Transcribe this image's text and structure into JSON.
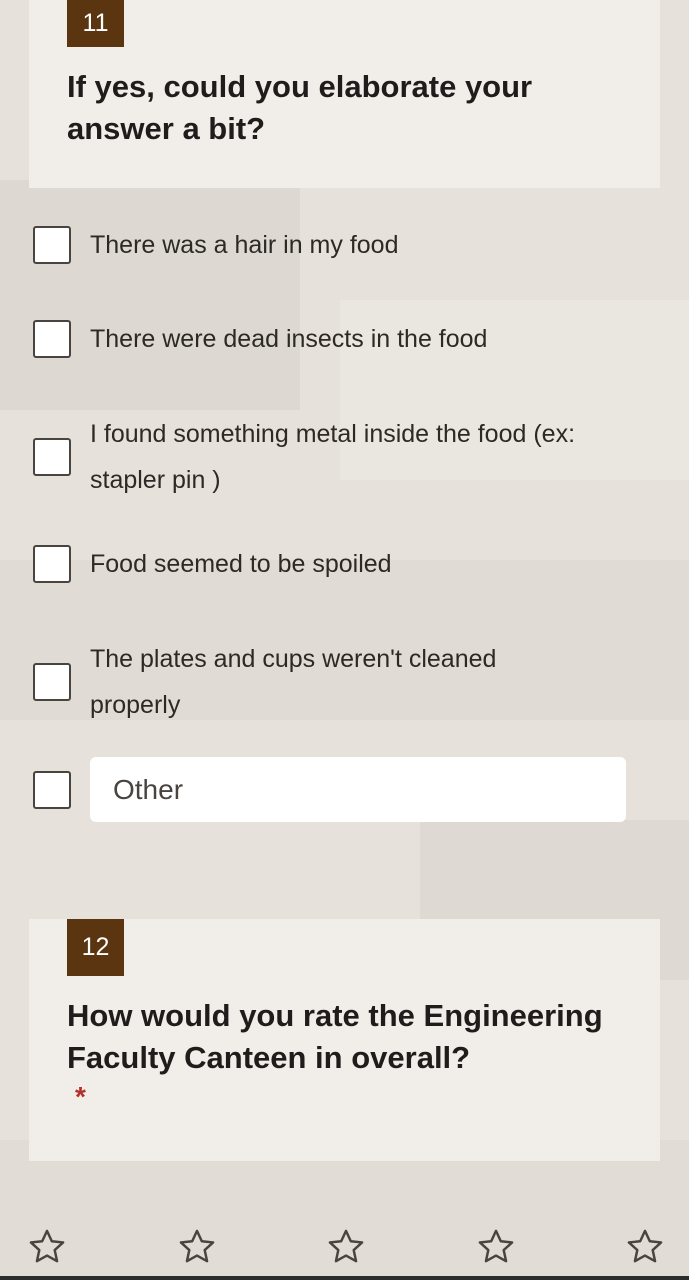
{
  "q11": {
    "number": "11",
    "title": "If yes, could you elaborate your answer a bit?",
    "options": [
      {
        "label": "There was a hair in my food"
      },
      {
        "label": "There were dead insects in the food"
      },
      {
        "label": "I found something metal inside the food (ex: stapler pin )"
      },
      {
        "label": "Food seemed to be spoiled"
      },
      {
        "label": "The plates and cups weren't cleaned properly"
      }
    ],
    "other_placeholder": "Other"
  },
  "q12": {
    "number": "12",
    "title": "How would you rate the Engineering Faculty Canteen in overall?",
    "required_mark": "*",
    "rating": {
      "max": 5,
      "selected": 0,
      "icon": "star-outline-icon"
    }
  },
  "colors": {
    "accent": "#5a3510",
    "card": "#f1ede8",
    "required": "#b3302a"
  }
}
